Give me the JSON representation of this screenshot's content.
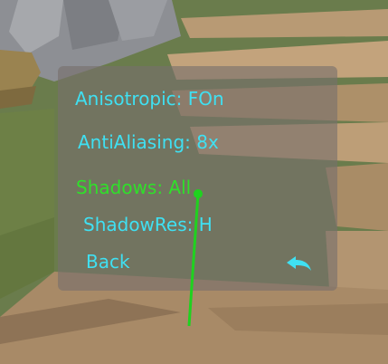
{
  "menu": {
    "items": [
      {
        "label": "Anisotropic: FOn",
        "selected": false
      },
      {
        "label": "AntiAliasing: 8x",
        "selected": false
      },
      {
        "label": "Shadows: All",
        "selected": true
      },
      {
        "label": "ShadowRes: H",
        "selected": false
      }
    ],
    "back_label": "Back",
    "back_icon": "undo-arrow-icon"
  },
  "colors": {
    "text": "#3fe0f2",
    "selected_text": "#2fe02a",
    "pointer": "#1fd21f",
    "panel": "#78706c"
  }
}
